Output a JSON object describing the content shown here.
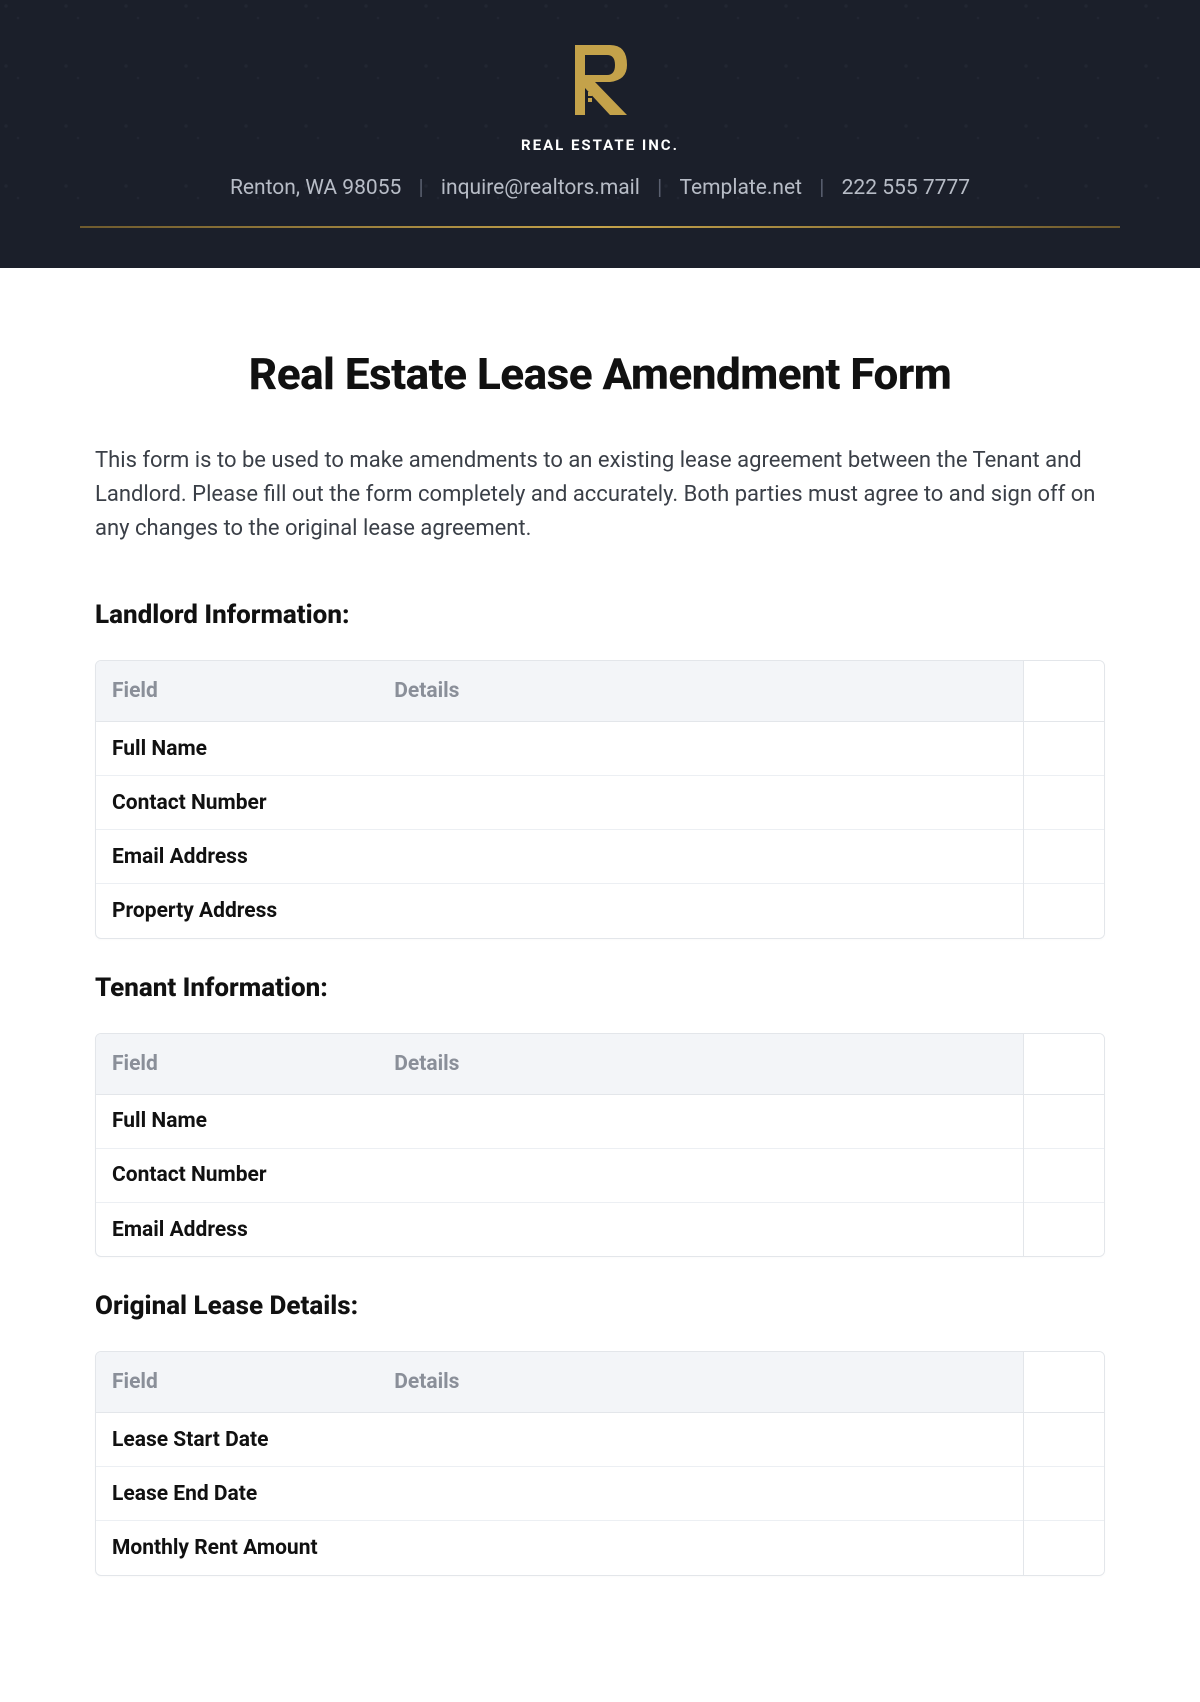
{
  "header": {
    "company_name": "REAL ESTATE INC.",
    "contacts": {
      "address": "Renton, WA 98055",
      "email": "inquire@realtors.mail",
      "website": "Template.net",
      "phone": "222 555 7777"
    }
  },
  "document": {
    "title": "Real Estate Lease Amendment Form",
    "intro": "This form is to be used to make amendments to an existing lease agreement between the Tenant and Landlord. Please fill out the form completely and accurately. Both parties must agree to and sign off on any changes to the original lease agreement."
  },
  "tables": {
    "header_field": "Field",
    "header_details": "Details"
  },
  "landlord": {
    "heading": "Landlord Information:",
    "rows": [
      {
        "field": "Full Name",
        "details": ""
      },
      {
        "field": "Contact Number",
        "details": ""
      },
      {
        "field": "Email Address",
        "details": ""
      },
      {
        "field": "Property Address",
        "details": ""
      }
    ]
  },
  "tenant": {
    "heading": "Tenant Information:",
    "rows": [
      {
        "field": "Full Name",
        "details": ""
      },
      {
        "field": "Contact Number",
        "details": ""
      },
      {
        "field": "Email Address",
        "details": ""
      }
    ]
  },
  "original_lease": {
    "heading": "Original Lease Details:",
    "rows": [
      {
        "field": "Lease Start Date",
        "details": ""
      },
      {
        "field": "Lease End Date",
        "details": ""
      },
      {
        "field": "Monthly Rent Amount",
        "details": ""
      }
    ]
  }
}
